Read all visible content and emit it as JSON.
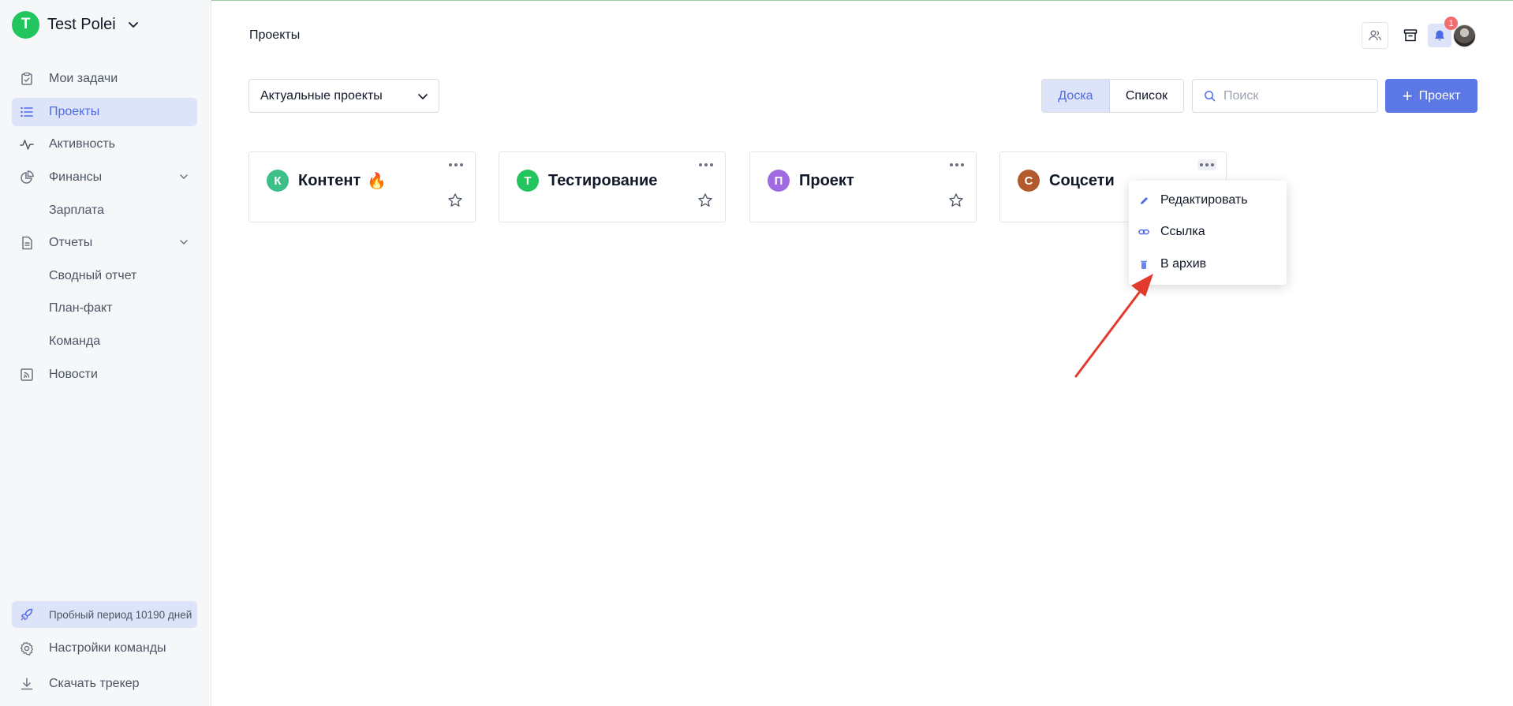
{
  "team": {
    "initial": "T",
    "name": "Test Polei"
  },
  "nav": {
    "my_tasks": "Мои задачи",
    "projects": "Проекты",
    "activity": "Активность",
    "finance": "Финансы",
    "salary": "Зарплата",
    "reports": "Отчеты",
    "summary_report": "Сводный отчет",
    "plan_fact": "План-факт",
    "team": "Команда",
    "news": "Новости"
  },
  "footer": {
    "trial": "Пробный период 10190 дней",
    "team_settings": "Настройки команды",
    "download_tracker": "Скачать трекер"
  },
  "breadcrumb": "Проекты",
  "notifications": {
    "count": "1"
  },
  "filter": {
    "selected": "Актуальные проекты"
  },
  "view_toggle": {
    "board": "Доска",
    "list": "Список",
    "active": "board"
  },
  "search": {
    "placeholder": "Поиск",
    "value": ""
  },
  "add_button": {
    "label": "Проект"
  },
  "projects": [
    {
      "initial": "К",
      "name": "Контент",
      "emoji": "🔥",
      "color": "#3dbf8a"
    },
    {
      "initial": "Т",
      "name": "Тестирование",
      "emoji": "",
      "color": "#22c55e"
    },
    {
      "initial": "П",
      "name": "Проект",
      "emoji": "",
      "color": "#a06be0"
    },
    {
      "initial": "С",
      "name": "Соцсети",
      "emoji": "",
      "color": "#b25a2c"
    }
  ],
  "context_menu": {
    "edit": "Редактировать",
    "link": "Ссылка",
    "archive": "В архив"
  },
  "colors": {
    "accent": "#5b78e5",
    "active_bg": "#dde3f8",
    "arrow": "#e23b2e"
  }
}
